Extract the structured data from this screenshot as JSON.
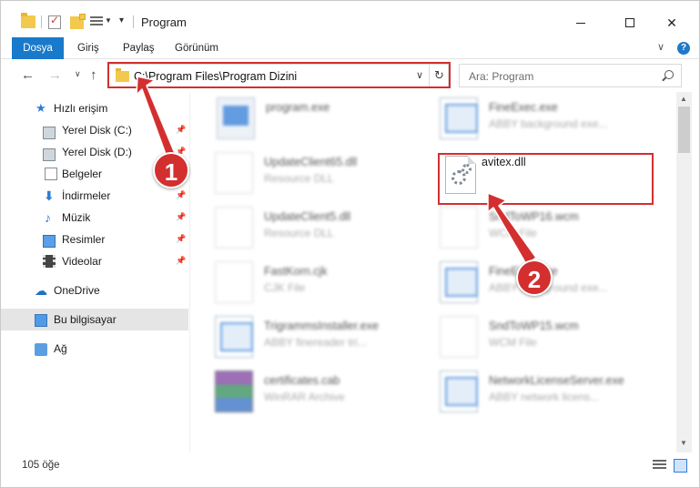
{
  "window": {
    "title": "Program",
    "minimize_icon": "minimize-icon",
    "maximize_icon": "maximize-icon",
    "close_symbol": "✕"
  },
  "ribbon": {
    "tabs": [
      "Dosya",
      "Giriş",
      "Paylaş",
      "Görünüm"
    ],
    "help_label": "?"
  },
  "navigation": {
    "back": "←",
    "forward": "→",
    "recent": "∨",
    "up": "↑",
    "address": "C:\\Program Files\\Program Dizini",
    "address_dropdown": "∨",
    "refresh": "↻",
    "search_placeholder": "Ara: Program"
  },
  "sidebar": {
    "items": [
      {
        "label": "Hızlı erişim",
        "icon": "star-icon",
        "pinned": false
      },
      {
        "label": "Yerel Disk (C:)",
        "icon": "drive-icon",
        "pinned": true
      },
      {
        "label": "Yerel Disk (D:)",
        "icon": "drive-icon",
        "pinned": true
      },
      {
        "label": "Belgeler",
        "icon": "documents-icon",
        "pinned": true
      },
      {
        "label": "İndirmeler",
        "icon": "download-icon",
        "pinned": true
      },
      {
        "label": "Müzik",
        "icon": "music-icon",
        "pinned": true
      },
      {
        "label": "Resimler",
        "icon": "pictures-icon",
        "pinned": true
      },
      {
        "label": "Videolar",
        "icon": "videos-icon",
        "pinned": true
      },
      {
        "label": "OneDrive",
        "icon": "onedrive-icon",
        "pinned": false
      },
      {
        "label": "Bu bilgisayar",
        "icon": "computer-icon",
        "pinned": false,
        "selected": true
      },
      {
        "label": "Ağ",
        "icon": "network-icon",
        "pinned": false
      }
    ],
    "pin_glyph": "📌"
  },
  "files": {
    "left_column": [
      {
        "name": "program.exe",
        "desc": "",
        "icon": "installer-icon"
      },
      {
        "name": "UpdateClient65.dll",
        "desc": "Resource DLL",
        "icon": "dll-file-icon"
      },
      {
        "name": "UpdateClient5.dll",
        "desc": "Resource DLL",
        "icon": "dll-file-icon"
      },
      {
        "name": "FastKorn.cjk",
        "desc": "CJK File",
        "icon": "generic-file-icon"
      },
      {
        "name": "TrigrammsInstaller.exe",
        "desc": "ABBY finereader tri...",
        "icon": "exe-window-icon"
      },
      {
        "name": "certificates.cab",
        "desc": "WinRAR Archive",
        "icon": "winrar-icon"
      }
    ],
    "right_column": [
      {
        "name": "FineExec.exe",
        "desc": "ABBY background exe...",
        "icon": "exe-window-icon"
      },
      {
        "name": "avitex.dll",
        "desc": "",
        "icon": "dll-gear-icon",
        "highlighted": true
      },
      {
        "name": "SndToWP16.wcm",
        "desc": "WCM File",
        "icon": "generic-file-icon"
      },
      {
        "name": "FineExec.exe",
        "desc": "ABBY background exe...",
        "icon": "exe-window-icon"
      },
      {
        "name": "SndToWP15.wcm",
        "desc": "WCM File",
        "icon": "generic-file-icon"
      },
      {
        "name": "NetworkLicenseServer.exe",
        "desc": "ABBY network licens...",
        "icon": "exe-window-icon"
      }
    ]
  },
  "status": {
    "item_count": "105 öğe"
  },
  "callouts": {
    "first": "1",
    "second": "2"
  },
  "colors": {
    "accent": "#1979ca",
    "highlight": "#d32f2f"
  }
}
